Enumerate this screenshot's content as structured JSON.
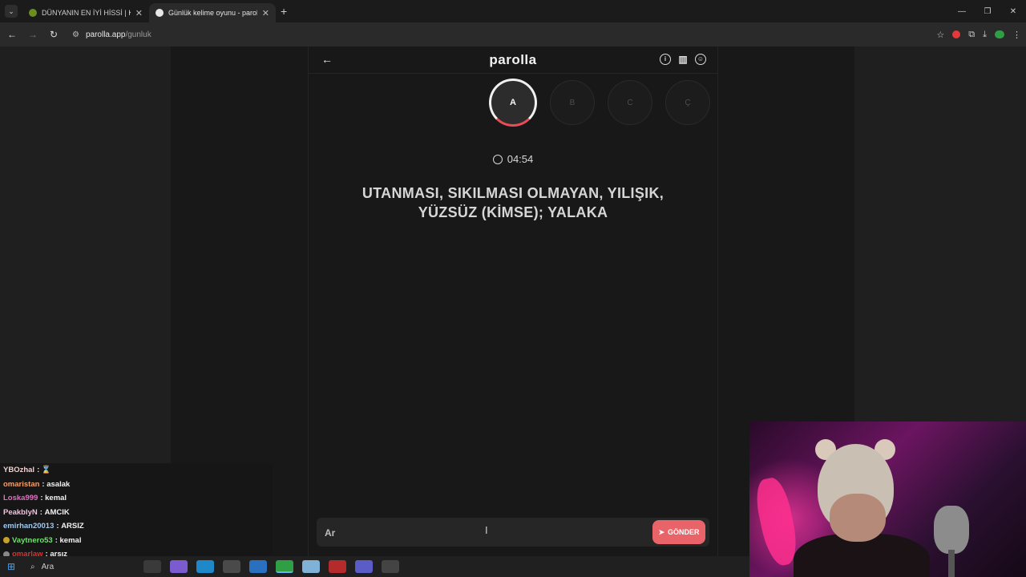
{
  "browser": {
    "tabs": [
      {
        "title": "DÜNYANIN EN İYİ HİSSİ | KÖR S",
        "active": false,
        "favicon_color": "#6b8e23"
      },
      {
        "title": "Günlük kelime oyunu - parolla",
        "active": true,
        "favicon_color": "#e8e8e8"
      }
    ],
    "new_tab_icon": "plus-icon",
    "url_host": "parolla.app",
    "url_path": "/gunluk",
    "window_controls": [
      "minimize-icon",
      "restore-icon",
      "close-icon"
    ]
  },
  "app": {
    "brand": "parolla",
    "header_icons": [
      "info-icon",
      "stats-icon",
      "profile-icon"
    ],
    "letters": [
      {
        "label": "A",
        "active": true
      },
      {
        "label": "B",
        "active": false
      },
      {
        "label": "C",
        "active": false
      },
      {
        "label": "Ç",
        "active": false
      }
    ],
    "timer": "04:54",
    "clue": "UTANMASI, SIKILMASI OLMAYAN, YILIŞIK, YÜZSÜZ (KİMSE); YALAKA",
    "answer_value": "Ar",
    "send_label": "GÖNDER",
    "accent_color": "#e86469"
  },
  "chat": {
    "lines": [
      {
        "user": "YBOzhal",
        "message": "",
        "user_color": "#f0d0d0",
        "emote": true
      },
      {
        "user": "omaristan",
        "message": "asalak",
        "user_color": "#f0a070"
      },
      {
        "user": "Loska999",
        "message": "kemal",
        "user_color": "#e070c0"
      },
      {
        "user": "PeakblyN",
        "message": "AMCIK",
        "user_color": "#f0c0e0"
      },
      {
        "user": "emirhan20013",
        "message": "ARSIZ",
        "user_color": "#a0c8f0"
      },
      {
        "user": "Vaytnero53",
        "message": "kemal",
        "user_color": "#70e070",
        "badge": true
      },
      {
        "user": "omarlaw",
        "message": "arsız",
        "user_color": "#e03030",
        "badge": true
      }
    ]
  },
  "taskbar": {
    "search_label": "Ara"
  }
}
